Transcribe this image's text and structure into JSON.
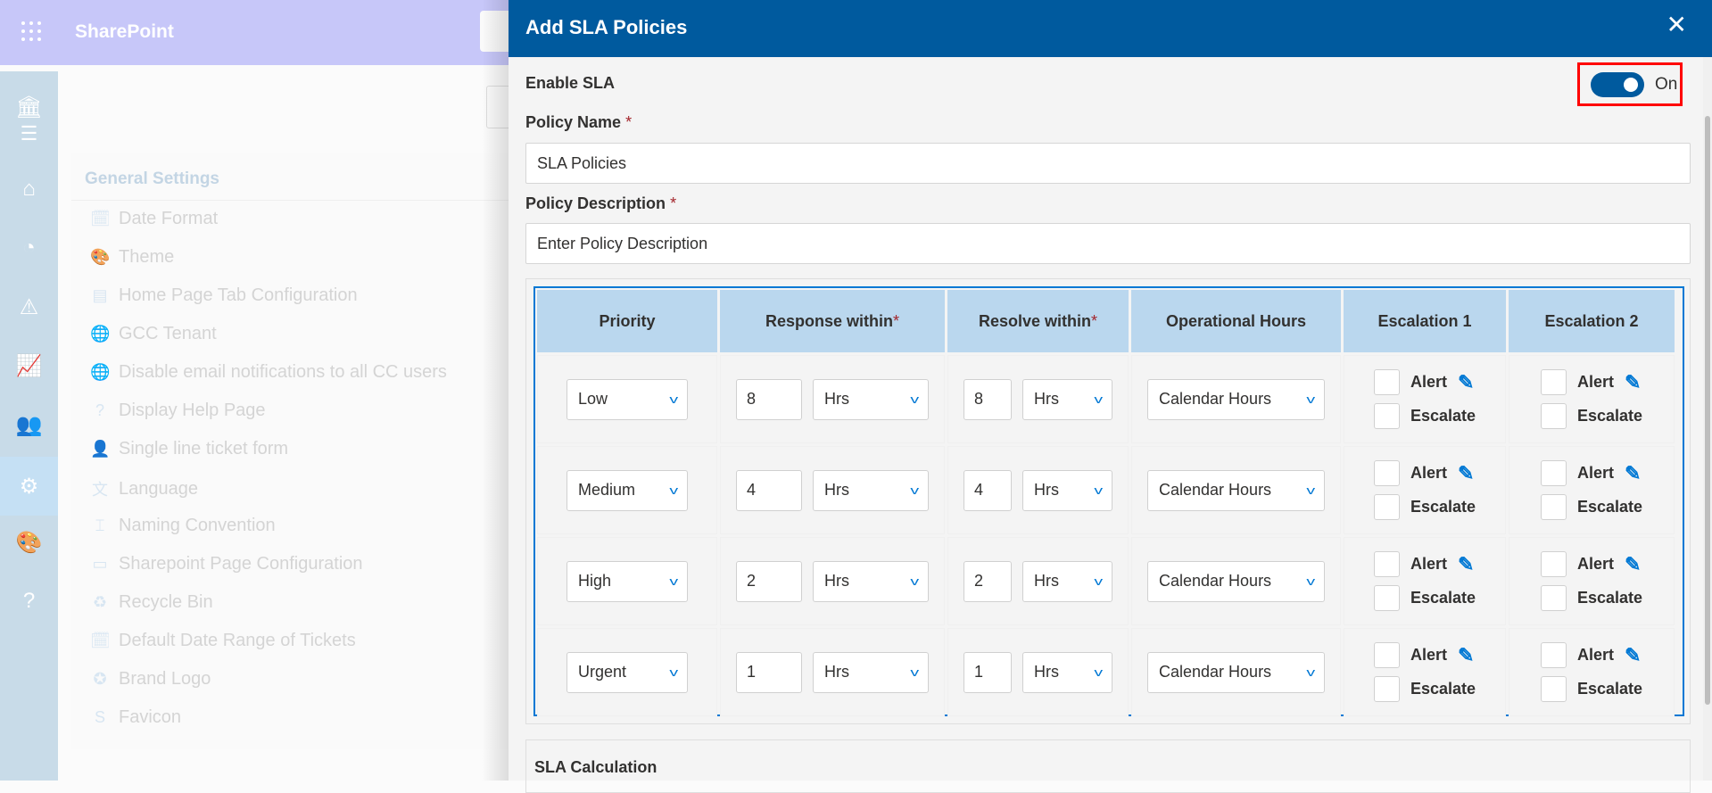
{
  "app": {
    "title": "SharePoint"
  },
  "sidebar": {
    "icons": [
      "bank-icon",
      "menu-icon",
      "home-icon",
      "dashboard-icon",
      "warning-icon",
      "chart-icon",
      "users-icon",
      "gear-icon",
      "palette-icon",
      "help-icon"
    ],
    "active": "gear-icon"
  },
  "settings": {
    "title": "General Settings",
    "items": [
      {
        "label": "Date Format",
        "icon": "calendar-clock-icon"
      },
      {
        "label": "Theme",
        "icon": "palette-icon"
      },
      {
        "label": "Home Page Tab Configuration",
        "icon": "document-icon"
      },
      {
        "label": "GCC Tenant",
        "icon": "globe-icon"
      },
      {
        "label": "Disable email notifications to all CC users",
        "icon": "globe-icon"
      },
      {
        "label": "Display Help Page",
        "icon": "help-icon"
      },
      {
        "label": "Single line ticket form",
        "icon": "person-remove-icon"
      },
      {
        "label": "Language",
        "icon": "translate-icon"
      },
      {
        "label": "Naming Convention",
        "icon": "rename-icon"
      },
      {
        "label": "Sharepoint Page Configuration",
        "icon": "window-icon"
      },
      {
        "label": "Recycle Bin",
        "icon": "recycle-bin-icon"
      },
      {
        "label": "Default Date Range of Tickets",
        "icon": "calendar-clock-icon"
      },
      {
        "label": "Brand Logo",
        "icon": "badge-check-icon"
      },
      {
        "label": "Favicon",
        "icon": "sharepoint-icon"
      }
    ]
  },
  "modal": {
    "title": "Add SLA Policies",
    "close": "✕",
    "enable_label": "Enable SLA",
    "toggle_state": "On",
    "toggle_on": true,
    "policy_name_label": "Policy Name",
    "policy_name_value": "SLA Policies",
    "policy_desc_label": "Policy Description",
    "policy_desc_placeholder": "Enter Policy Description",
    "required_mark": "*",
    "table": {
      "headers": [
        "Priority",
        "Response within",
        "Resolve within",
        "Operational Hours",
        "Escalation 1",
        "Escalation 2"
      ],
      "rows": [
        {
          "priority": "Low",
          "response": "8",
          "response_unit": "Hrs",
          "resolve": "8",
          "resolve_unit": "Hrs",
          "hours": "Calendar Hours"
        },
        {
          "priority": "Medium",
          "response": "4",
          "response_unit": "Hrs",
          "resolve": "4",
          "resolve_unit": "Hrs",
          "hours": "Calendar Hours"
        },
        {
          "priority": "High",
          "response": "2",
          "response_unit": "Hrs",
          "resolve": "2",
          "resolve_unit": "Hrs",
          "hours": "Calendar Hours"
        },
        {
          "priority": "Urgent",
          "response": "1",
          "response_unit": "Hrs",
          "resolve": "1",
          "resolve_unit": "Hrs",
          "hours": "Calendar Hours"
        }
      ],
      "alert_label": "Alert",
      "escalate_label": "Escalate"
    },
    "sla_calc_label": "SLA Calculation"
  },
  "colors": {
    "header": "#005a9e",
    "accent": "#0078d4",
    "table_header": "#bad7ee",
    "highlight": "#ff0000"
  }
}
